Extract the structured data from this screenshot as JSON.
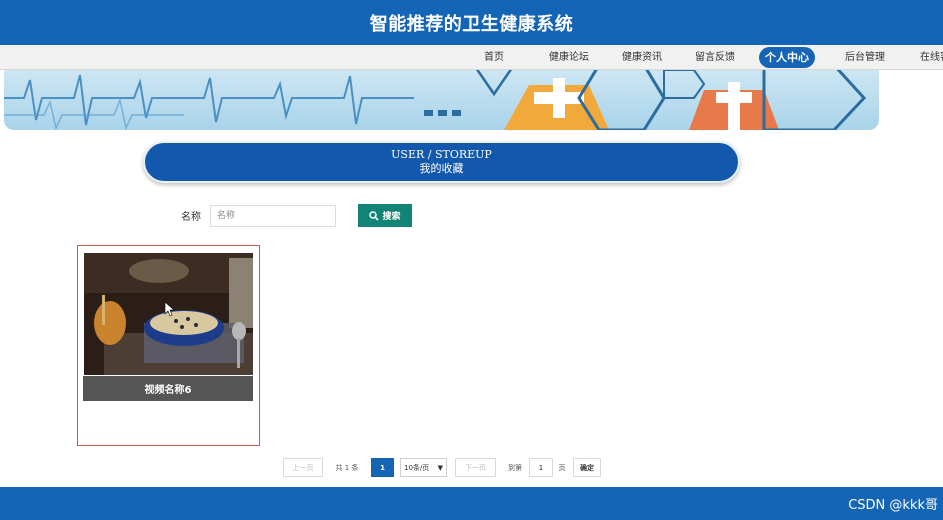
{
  "header": {
    "title": "智能推荐的卫生健康系统"
  },
  "nav": {
    "items": [
      {
        "label": "首页"
      },
      {
        "label": "健康论坛"
      },
      {
        "label": "健康资讯"
      },
      {
        "label": "留言反馈"
      },
      {
        "label": "个人中心",
        "active": true
      },
      {
        "label": "后台管理"
      },
      {
        "label": "在线客"
      }
    ]
  },
  "section": {
    "title_en": "USER / STOREUP",
    "title_cn": "我的收藏"
  },
  "search": {
    "label": "名称",
    "input_placeholder": "名称",
    "input_value": "",
    "button_label": "搜索",
    "button_icon": "search-icon"
  },
  "items": [
    {
      "title": "视频名称6"
    }
  ],
  "pagination": {
    "prev_label": "上一页",
    "total_text": "共 1 条",
    "current_page": "1",
    "page_size_label": "10条/页",
    "next_label": "下一页",
    "goto_label": "到第",
    "goto_value": "1",
    "page_unit": "页",
    "confirm_label": "确定"
  },
  "footer": {
    "watermark": "CSDN @kkk哥"
  },
  "colors": {
    "primary": "#1565b6",
    "search_button": "#128476",
    "card_border": "#c8584e"
  }
}
